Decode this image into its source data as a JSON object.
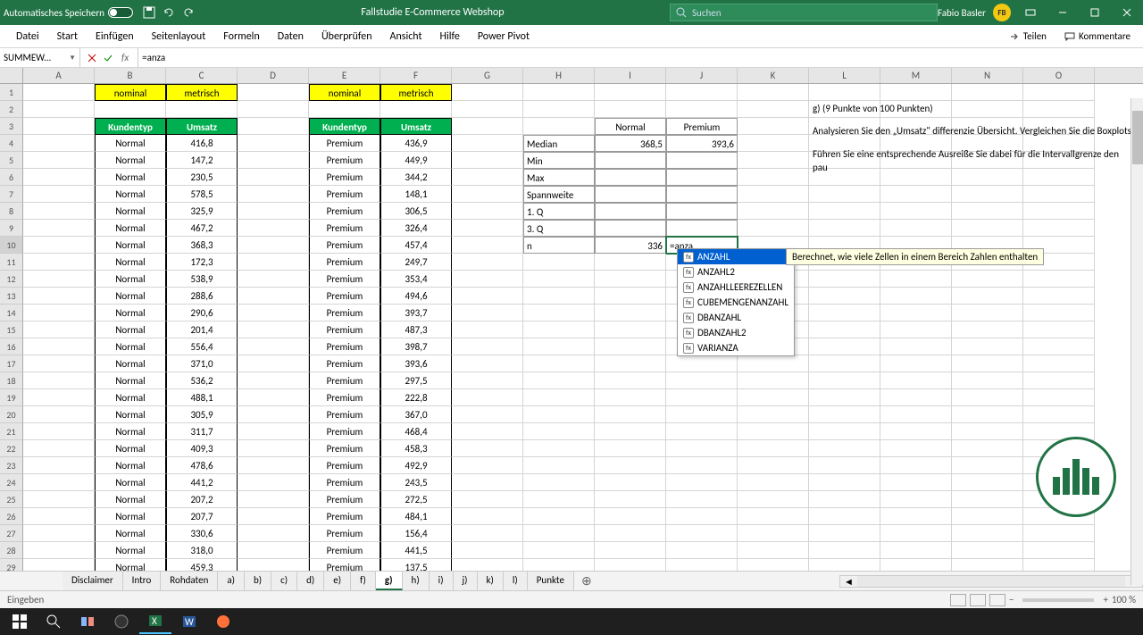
{
  "titlebar": {
    "autosave": "Automatisches Speichern",
    "doc": "Fallstudie E-Commerce Webshop",
    "search_ph": "Suchen",
    "user": "Fabio Basler",
    "initials": "FB"
  },
  "ribbon": {
    "tabs": [
      "Datei",
      "Start",
      "Einfügen",
      "Seitenlayout",
      "Formeln",
      "Daten",
      "Überprüfen",
      "Ansicht",
      "Hilfe",
      "Power Pivot"
    ],
    "share": "Teilen",
    "comments": "Kommentare"
  },
  "namebox": "SUMMEW...",
  "formula": "=anza",
  "cols": [
    "A",
    "B",
    "C",
    "D",
    "E",
    "F",
    "G",
    "H",
    "I",
    "J",
    "K",
    "L",
    "M",
    "N",
    "O"
  ],
  "headers": {
    "nominal": "nominal",
    "metrisch": "metrisch",
    "kundentyp": "Kundentyp",
    "umsatz": "Umsatz"
  },
  "normal_data": [
    "416,8",
    "147,2",
    "230,5",
    "578,5",
    "325,9",
    "467,2",
    "368,3",
    "172,3",
    "538,9",
    "288,6",
    "290,6",
    "201,4",
    "556,4",
    "371,0",
    "536,2",
    "488,1",
    "305,9",
    "311,7",
    "409,3",
    "478,6",
    "441,2",
    "207,2",
    "207,7",
    "330,6",
    "318,0",
    "459,3"
  ],
  "premium_data": [
    "436,9",
    "449,9",
    "344,2",
    "148,1",
    "306,5",
    "326,4",
    "457,4",
    "249,7",
    "353,4",
    "494,6",
    "393,7",
    "487,3",
    "398,7",
    "393,6",
    "297,5",
    "222,8",
    "367,0",
    "468,4",
    "458,3",
    "492,9",
    "243,5",
    "272,5",
    "484,1",
    "156,4",
    "441,5",
    "137,5"
  ],
  "normal_label": "Normal",
  "premium_label": "Premium",
  "stats": {
    "hdr_normal": "Normal",
    "hdr_premium": "Premium",
    "rows": [
      "Median",
      "Min",
      "Max",
      "Spannweite",
      "1. Q",
      "3. Q",
      "n"
    ],
    "median_n": "368,5",
    "median_p": "393,6",
    "n_normal": "336",
    "n_formula": "=anza"
  },
  "autocomplete": [
    "ANZAHL",
    "ANZAHL2",
    "ANZAHLLEEREZELLEN",
    "CUBEMENGENANZAHL",
    "DBANZAHL",
    "DBANZAHL2",
    "VARIANZA"
  ],
  "ac_tip": "Berechnet, wie viele Zellen in einem Bereich Zahlen enthalten",
  "task": {
    "title": "g) (9 Punkte von 100 Punkten)",
    "p1": "Analysieren Sie den „Umsatz\" differenzie Übersicht. Vergleichen Sie die Boxplots",
    "p2": "Führen Sie eine entsprechende Ausreiße Sie dabei für die Intervallgrenze den pau"
  },
  "sheets": [
    "Disclaimer",
    "Intro",
    "Rohdaten",
    "a)",
    "b)",
    "c)",
    "d)",
    "e)",
    "f)",
    "g)",
    "h)",
    "i)",
    "j)",
    "k)",
    "l)",
    "Punkte"
  ],
  "active_sheet": "g)",
  "status": "Eingeben",
  "zoom": "100 %"
}
